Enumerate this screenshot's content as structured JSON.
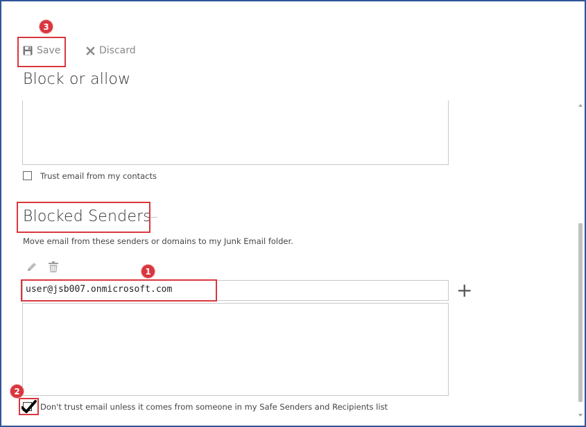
{
  "toolbar": {
    "save_label": "Save",
    "discard_label": "Discard"
  },
  "sections": {
    "block_or_allow_title": "Block or allow",
    "trust_contacts_label": "Trust email from my contacts",
    "blocked_senders_title": "Blocked Senders",
    "blocked_senders_description": "Move email from these senders or domains to my Junk Email folder."
  },
  "blocked_senders": {
    "input_value": "user@jsb007.onmicrosoft.com",
    "add_symbol": "+"
  },
  "footer": {
    "dont_trust_label": "Don't trust email unless it comes from someone in my Safe Senders and Recipients list"
  },
  "annotations": {
    "step1": "1",
    "step2": "2",
    "step3": "3"
  },
  "colors": {
    "annotation_red": "#d9363e",
    "window_border": "#2f5597"
  }
}
